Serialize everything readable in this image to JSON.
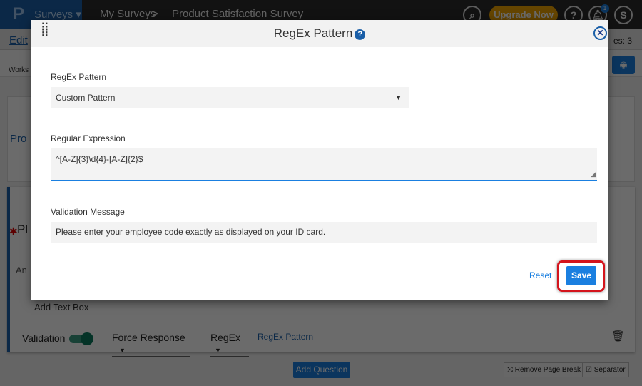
{
  "topbar": {
    "logo": "P",
    "product": "Surveys ▾",
    "breadcrumb": [
      "My Surveys",
      ">",
      "Product Satisfaction Survey"
    ],
    "upgrade": "Upgrade Now",
    "help": "?",
    "notifications_count": "1",
    "avatar": "S"
  },
  "subbar": {
    "edit": "Edit",
    "pages": "es: 3"
  },
  "toolbar": {
    "workspace": "Works"
  },
  "background": {
    "page_title": "Pro",
    "question_text": "Pl",
    "answer_placeholder": "An",
    "add_text_box": "Add Text Box",
    "validation_label": "Validation",
    "validation_on": true,
    "force_response": "Force Response",
    "regex_select": "RegEx",
    "regex_link": "RegEx Pattern",
    "add_question": "Add Question",
    "remove_page_break": "Remove Page Break",
    "separator": "Separator"
  },
  "modal": {
    "title": "RegEx Pattern",
    "pattern_label": "RegEx Pattern",
    "pattern_value": "Custom Pattern",
    "regex_label": "Regular Expression",
    "regex_value": "^[A-Z]{3}\\d{4}-[A-Z]{2}$",
    "message_label": "Validation Message",
    "message_value": "Please enter your employee code exactly as displayed on your ID card.",
    "reset": "Reset",
    "save": "Save"
  },
  "colors": {
    "accent": "#1a7fe0",
    "brand": "#1a5fa8",
    "highlight": "#d4141c",
    "upgrade": "#f0a500"
  }
}
